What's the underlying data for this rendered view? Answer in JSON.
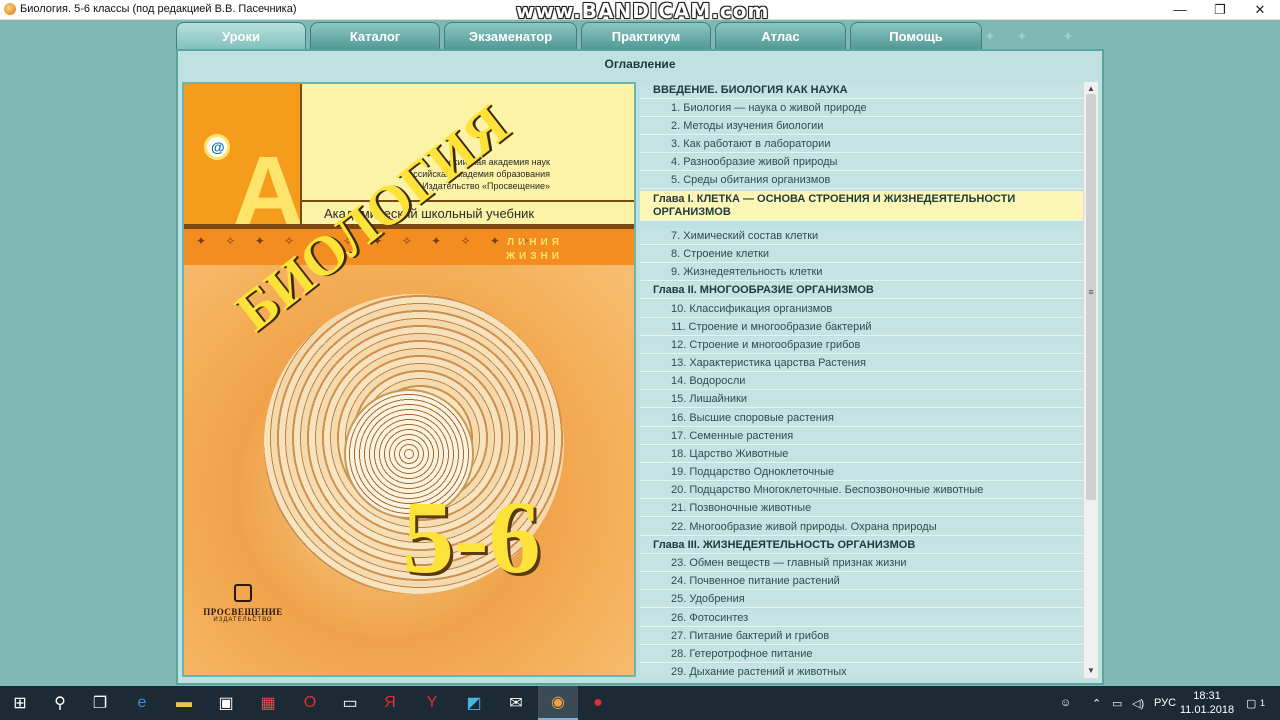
{
  "window": {
    "title": "Биология. 5-6 классы (под редакцией В.В. Пасечника)",
    "watermark": "www.BANDICAM.com",
    "controls": {
      "minimize": "—",
      "maximize": "❐",
      "close": "✕"
    }
  },
  "tabs": [
    {
      "label": "Уроки",
      "active": true
    },
    {
      "label": "Каталог",
      "active": false
    },
    {
      "label": "Экзаменатор",
      "active": false
    },
    {
      "label": "Практикум",
      "active": false
    },
    {
      "label": "Атлас",
      "active": false
    },
    {
      "label": "Помощь",
      "active": false
    }
  ],
  "panel": {
    "title": "Оглавление"
  },
  "cover": {
    "letter": "А",
    "academy_lines": [
      "Российская академия наук",
      "Российская академия образования",
      "Издательство «Просвещение»"
    ],
    "series": "Академический школьный учебник",
    "line_label_1": "ЛИНИЯ",
    "line_label_2": "ЖИЗНИ",
    "title": "БИОЛОГИЯ",
    "grade": "5-6",
    "publisher_name": "ПРОСВЕЩЕНИЕ",
    "publisher_sub": "ИЗДАТЕЛЬСТВО"
  },
  "toc": [
    {
      "type": "chapter",
      "text": "ВВЕДЕНИЕ. БИОЛОГИЯ КАК НАУКА"
    },
    {
      "type": "item",
      "text": "1. Биология — наука о живой природе"
    },
    {
      "type": "item",
      "text": "2. Методы изучения биологии"
    },
    {
      "type": "item",
      "text": "3. Как работают в лаборатории"
    },
    {
      "type": "item",
      "text": "4. Разнообразие живой природы"
    },
    {
      "type": "item",
      "text": "5. Среды обитания организмов"
    },
    {
      "type": "chapter-highlight",
      "text": "Глава I. КЛЕТКА — ОСНОВА СТРОЕНИЯ И ЖИЗНЕДЕЯТЕЛЬНОСТИ ОРГАНИЗМОВ"
    },
    {
      "type": "item",
      "text": "7. Химический состав клетки"
    },
    {
      "type": "item",
      "text": "8. Строение клетки"
    },
    {
      "type": "item",
      "text": "9. Жизнедеятельность клетки"
    },
    {
      "type": "chapter",
      "text": "Глава II. МНОГООБРАЗИЕ ОРГАНИЗМОВ"
    },
    {
      "type": "item",
      "text": "10. Классификация организмов"
    },
    {
      "type": "item",
      "text": "11. Строение и многообразие бактерий"
    },
    {
      "type": "item",
      "text": "12. Строение и многообразие грибов"
    },
    {
      "type": "item",
      "text": "13. Характеристика царства Растения"
    },
    {
      "type": "item",
      "text": "14. Водоросли"
    },
    {
      "type": "item",
      "text": "15. Лишайники"
    },
    {
      "type": "item",
      "text": "16. Высшие споровые растения"
    },
    {
      "type": "item",
      "text": "17. Семенные растения"
    },
    {
      "type": "item",
      "text": "18. Царство Животные"
    },
    {
      "type": "item",
      "text": "19. Подцарство Одноклеточные"
    },
    {
      "type": "item",
      "text": "20. Подцарство Многоклеточные. Беспозвоночные животные"
    },
    {
      "type": "item",
      "text": "21. Позвоночные животные"
    },
    {
      "type": "item",
      "text": "22. Многообразие живой природы. Охрана природы"
    },
    {
      "type": "chapter",
      "text": "Глава III. ЖИЗНЕДЕЯТЕЛЬНОСТЬ ОРГАНИЗМОВ"
    },
    {
      "type": "item",
      "text": "23. Обмен веществ — главный признак жизни"
    },
    {
      "type": "item",
      "text": "24. Почвенное питание растений"
    },
    {
      "type": "item",
      "text": "25. Удобрения"
    },
    {
      "type": "item",
      "text": "26. Фотосинтез"
    },
    {
      "type": "item",
      "text": "27. Питание бактерий и грибов"
    },
    {
      "type": "item",
      "text": "28. Гетеротрофное питание"
    },
    {
      "type": "item",
      "text": "29. Дыхание растений и животных"
    }
  ],
  "taskbar": {
    "icons": [
      "windows-start-icon",
      "search-icon",
      "task-view-icon",
      "edge-browser-icon",
      "file-explorer-icon",
      "store-icon",
      "gift-icon",
      "opera-icon",
      "notepad-icon",
      "yandex-icon",
      "yandex-browser-icon",
      "photos-icon",
      "mail-icon",
      "biology-app-icon",
      "bandicam-record-icon"
    ],
    "language": "РУС",
    "time": "18:31",
    "date": "11.01.2018",
    "notifications": "1"
  }
}
